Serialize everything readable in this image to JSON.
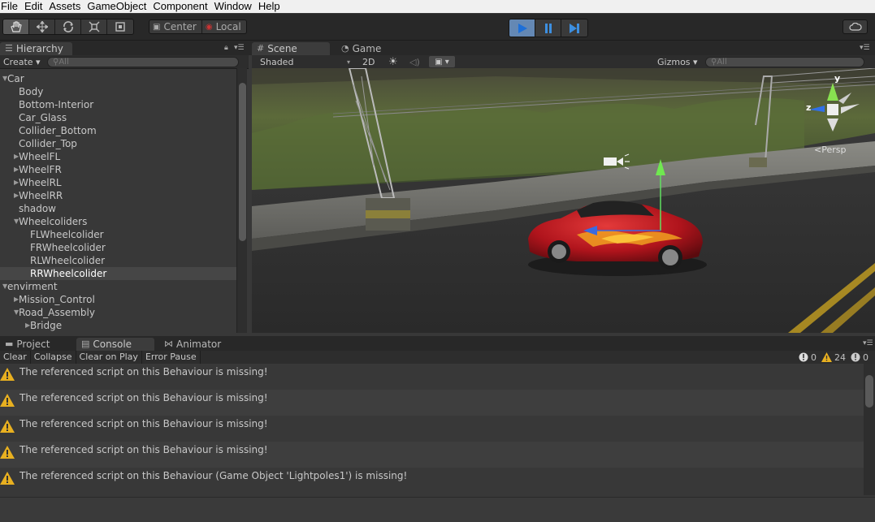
{
  "menu": [
    "File",
    "Edit",
    "Assets",
    "GameObject",
    "Component",
    "Window",
    "Help"
  ],
  "toolbar": {
    "transform_tools": [
      "hand-icon",
      "move-icon",
      "rotate-icon",
      "scale-icon",
      "rect-icon"
    ],
    "pivot_center": "Center",
    "pivot_local": "Local",
    "play_buttons": [
      "play-icon",
      "pause-icon",
      "step-icon"
    ],
    "play_active": true,
    "cloud": "cloud-icon"
  },
  "hierarchy": {
    "tab": "Hierarchy",
    "create": "Create",
    "search_placeholder": "All",
    "items": [
      {
        "label": "Car",
        "depth": 0,
        "expanded": true,
        "arrow": true
      },
      {
        "label": "Body",
        "depth": 1,
        "arrow": false
      },
      {
        "label": "Bottom-Interior",
        "depth": 1,
        "arrow": false
      },
      {
        "label": "Car_Glass",
        "depth": 1,
        "arrow": false
      },
      {
        "label": "Collider_Bottom",
        "depth": 1,
        "arrow": false
      },
      {
        "label": "Collider_Top",
        "depth": 1,
        "arrow": false
      },
      {
        "label": "WheelFL",
        "depth": 1,
        "arrow": true,
        "expanded": false
      },
      {
        "label": "WheelFR",
        "depth": 1,
        "arrow": true,
        "expanded": false
      },
      {
        "label": "WheelRL",
        "depth": 1,
        "arrow": true,
        "expanded": false
      },
      {
        "label": "WheelRR",
        "depth": 1,
        "arrow": true,
        "expanded": false
      },
      {
        "label": "shadow",
        "depth": 1,
        "arrow": false
      },
      {
        "label": "Wheelcoliders",
        "depth": 1,
        "arrow": true,
        "expanded": true
      },
      {
        "label": "FLWheelcolider",
        "depth": 2,
        "arrow": false
      },
      {
        "label": "FRWheelcolider",
        "depth": 2,
        "arrow": false
      },
      {
        "label": "RLWheelcolider",
        "depth": 2,
        "arrow": false
      },
      {
        "label": "RRWheelcolider",
        "depth": 2,
        "arrow": false,
        "selected": true
      },
      {
        "label": "envirment",
        "depth": 0,
        "arrow": true,
        "expanded": true
      },
      {
        "label": "Mission_Control",
        "depth": 1,
        "arrow": true,
        "expanded": false
      },
      {
        "label": "Road_Assembly",
        "depth": 1,
        "arrow": true,
        "expanded": true
      },
      {
        "label": "Bridge",
        "depth": 2,
        "arrow": true,
        "expanded": false
      }
    ]
  },
  "scene": {
    "tab_scene": "Scene",
    "tab_game": "Game",
    "shading": "Shaded",
    "mode_2d": "2D",
    "gizmos": "Gizmos",
    "search_placeholder": "All",
    "persp_label": "Persp",
    "gizmo_y": "y",
    "gizmo_z": "z"
  },
  "bottom": {
    "tab_project": "Project",
    "tab_console": "Console",
    "tab_animator": "Animator",
    "buttons": [
      "Clear",
      "Collapse",
      "Clear on Play",
      "Error Pause"
    ],
    "count_info": "0",
    "count_warn": "24",
    "count_error": "0",
    "logs": [
      "The referenced script on this Behaviour is missing!",
      "The referenced script on this Behaviour is missing!",
      "The referenced script on this Behaviour is missing!",
      "The referenced script on this Behaviour is missing!",
      "The referenced script on this Behaviour (Game Object 'Lightpoles1') is missing!"
    ]
  },
  "colors": {
    "accent_play": "#3d8fe0",
    "warn": "#e8b020",
    "selection": "#464646",
    "car_red": "#b0141c"
  }
}
